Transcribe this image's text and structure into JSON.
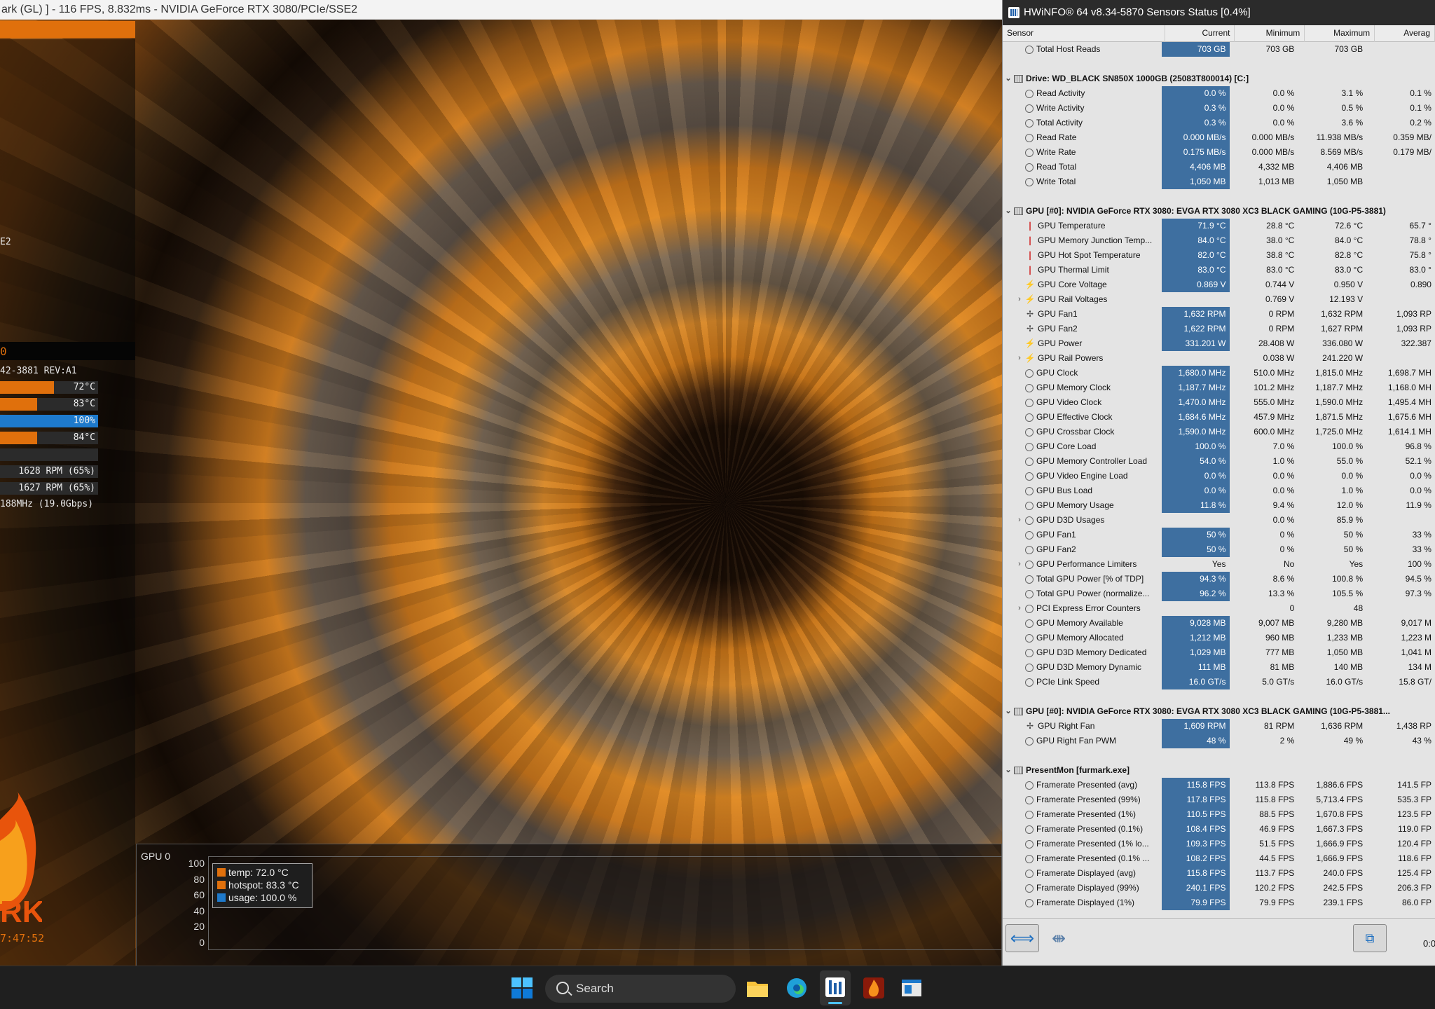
{
  "app_title": "ark (GL) ] - 116 FPS, 8.832ms - NVIDIA GeForce RTX 3080/PCIe/SSE2",
  "left_panel": {
    "sse": "E2",
    "black_label": "0",
    "gpu_line": "42-3881 REV:A1",
    "bars": [
      {
        "label": "72°C",
        "fill": 0.55,
        "color": "orange"
      },
      {
        "label": "83°C",
        "fill": 0.38,
        "color": "orange"
      },
      {
        "label": "100%",
        "fill": 1.0,
        "color": "blue"
      },
      {
        "label": "84°C",
        "fill": 0.38,
        "color": "orange"
      },
      {
        "label": "",
        "fill": 0.0,
        "color": "orange"
      },
      {
        "label": "1628 RPM (65%)",
        "fill": 0.0,
        "color": "orange"
      },
      {
        "label": "1627 RPM (65%)",
        "fill": 0.0,
        "color": "orange"
      }
    ],
    "mem_line": "188MHz (19.0Gbps)",
    "time": "7:47:52"
  },
  "graph": {
    "gpu_label": "GPU 0",
    "y_ticks": [
      "100",
      "80",
      "60",
      "40",
      "20",
      "0"
    ],
    "legend": [
      {
        "text": "temp: 72.0 °C",
        "color": "#e0700c"
      },
      {
        "text": "hotspot: 83.3 °C",
        "color": "#e0700c"
      },
      {
        "text": "usage: 100.0 %",
        "color": "#1e7acc"
      }
    ]
  },
  "hwinfo": {
    "title": "HWiNFO® 64 v8.34-5870 Sensors Status [0.4%]",
    "columns": [
      "Sensor",
      "Current",
      "Minimum",
      "Maximum",
      "Averag"
    ],
    "rows": [
      {
        "t": "item",
        "icon": "clock",
        "name": "Total Host Reads",
        "v": [
          "703 GB",
          "703 GB",
          "703 GB",
          ""
        ]
      },
      {
        "t": "empty"
      },
      {
        "t": "hdr",
        "name": "Drive: WD_BLACK SN850X 1000GB (25083T800014) [C:]"
      },
      {
        "t": "item",
        "icon": "clock",
        "name": "Read Activity",
        "v": [
          "0.0 %",
          "0.0 %",
          "3.1 %",
          "0.1 %"
        ]
      },
      {
        "t": "item",
        "icon": "clock",
        "name": "Write Activity",
        "v": [
          "0.3 %",
          "0.0 %",
          "0.5 %",
          "0.1 %"
        ]
      },
      {
        "t": "item",
        "icon": "clock",
        "name": "Total Activity",
        "v": [
          "0.3 %",
          "0.0 %",
          "3.6 %",
          "0.2 %"
        ]
      },
      {
        "t": "item",
        "icon": "clock",
        "name": "Read Rate",
        "v": [
          "0.000 MB/s",
          "0.000 MB/s",
          "11.938 MB/s",
          "0.359 MB/"
        ]
      },
      {
        "t": "item",
        "icon": "clock",
        "name": "Write Rate",
        "v": [
          "0.175 MB/s",
          "0.000 MB/s",
          "8.569 MB/s",
          "0.179 MB/"
        ]
      },
      {
        "t": "item",
        "icon": "clock",
        "name": "Read Total",
        "v": [
          "4,406 MB",
          "4,332 MB",
          "4,406 MB",
          ""
        ]
      },
      {
        "t": "item",
        "icon": "clock",
        "name": "Write Total",
        "v": [
          "1,050 MB",
          "1,013 MB",
          "1,050 MB",
          ""
        ]
      },
      {
        "t": "empty"
      },
      {
        "t": "hdr",
        "name": "GPU [#0]: NVIDIA GeForce RTX 3080: EVGA RTX 3080 XC3 BLACK GAMING (10G-P5-3881)"
      },
      {
        "t": "item",
        "icon": "therm",
        "name": "GPU Temperature",
        "v": [
          "71.9 °C",
          "28.8 °C",
          "72.6 °C",
          "65.7 °"
        ]
      },
      {
        "t": "item",
        "icon": "therm",
        "name": "GPU Memory Junction Temp...",
        "v": [
          "84.0 °C",
          "38.0 °C",
          "84.0 °C",
          "78.8 °"
        ]
      },
      {
        "t": "item",
        "icon": "therm",
        "name": "GPU Hot Spot Temperature",
        "v": [
          "82.0 °C",
          "38.8 °C",
          "82.8 °C",
          "75.8 °"
        ]
      },
      {
        "t": "item",
        "icon": "therm",
        "name": "GPU Thermal Limit",
        "v": [
          "83.0 °C",
          "83.0 °C",
          "83.0 °C",
          "83.0 °"
        ]
      },
      {
        "t": "item",
        "icon": "bolt",
        "name": "GPU Core Voltage",
        "v": [
          "0.869 V",
          "0.744 V",
          "0.950 V",
          "0.890 "
        ]
      },
      {
        "t": "sub",
        "icon": "bolt",
        "name": "GPU Rail Voltages",
        "v": [
          "",
          "0.769 V",
          "12.193 V",
          ""
        ]
      },
      {
        "t": "item",
        "icon": "fan",
        "name": "GPU Fan1",
        "v": [
          "1,632 RPM",
          "0 RPM",
          "1,632 RPM",
          "1,093 RP"
        ]
      },
      {
        "t": "item",
        "icon": "fan",
        "name": "GPU Fan2",
        "v": [
          "1,622 RPM",
          "0 RPM",
          "1,627 RPM",
          "1,093 RP"
        ]
      },
      {
        "t": "item",
        "icon": "bolt",
        "name": "GPU Power",
        "v": [
          "331.201 W",
          "28.408 W",
          "336.080 W",
          "322.387 "
        ]
      },
      {
        "t": "sub",
        "icon": "bolt",
        "name": "GPU Rail Powers",
        "v": [
          "",
          "0.038 W",
          "241.220 W",
          ""
        ]
      },
      {
        "t": "item",
        "icon": "clock",
        "name": "GPU Clock",
        "v": [
          "1,680.0 MHz",
          "510.0 MHz",
          "1,815.0 MHz",
          "1,698.7 MH"
        ]
      },
      {
        "t": "item",
        "icon": "clock",
        "name": "GPU Memory Clock",
        "v": [
          "1,187.7 MHz",
          "101.2 MHz",
          "1,187.7 MHz",
          "1,168.0 MH"
        ]
      },
      {
        "t": "item",
        "icon": "clock",
        "name": "GPU Video Clock",
        "v": [
          "1,470.0 MHz",
          "555.0 MHz",
          "1,590.0 MHz",
          "1,495.4 MH"
        ]
      },
      {
        "t": "item",
        "icon": "clock",
        "name": "GPU Effective Clock",
        "v": [
          "1,684.6 MHz",
          "457.9 MHz",
          "1,871.5 MHz",
          "1,675.6 MH"
        ]
      },
      {
        "t": "item",
        "icon": "clock",
        "name": "GPU Crossbar Clock",
        "v": [
          "1,590.0 MHz",
          "600.0 MHz",
          "1,725.0 MHz",
          "1,614.1 MH"
        ]
      },
      {
        "t": "item",
        "icon": "clock",
        "name": "GPU Core Load",
        "v": [
          "100.0 %",
          "7.0 %",
          "100.0 %",
          "96.8 %"
        ]
      },
      {
        "t": "item",
        "icon": "clock",
        "name": "GPU Memory Controller Load",
        "v": [
          "54.0 %",
          "1.0 %",
          "55.0 %",
          "52.1 %"
        ]
      },
      {
        "t": "item",
        "icon": "clock",
        "name": "GPU Video Engine Load",
        "v": [
          "0.0 %",
          "0.0 %",
          "0.0 %",
          "0.0 %"
        ]
      },
      {
        "t": "item",
        "icon": "clock",
        "name": "GPU Bus Load",
        "v": [
          "0.0 %",
          "0.0 %",
          "1.0 %",
          "0.0 %"
        ]
      },
      {
        "t": "item",
        "icon": "clock",
        "name": "GPU Memory Usage",
        "v": [
          "11.8 %",
          "9.4 %",
          "12.0 %",
          "11.9 %"
        ]
      },
      {
        "t": "sub",
        "icon": "clock",
        "name": "GPU D3D Usages",
        "v": [
          "",
          "0.0 %",
          "85.9 %",
          ""
        ]
      },
      {
        "t": "item",
        "icon": "clock",
        "name": "GPU Fan1",
        "v": [
          "50 %",
          "0 %",
          "50 %",
          "33 %"
        ]
      },
      {
        "t": "item",
        "icon": "clock",
        "name": "GPU Fan2",
        "v": [
          "50 %",
          "0 %",
          "50 %",
          "33 %"
        ]
      },
      {
        "t": "sub",
        "icon": "clock",
        "name": "GPU Performance Limiters",
        "v": [
          "Yes",
          "No",
          "Yes",
          "100 %"
        ]
      },
      {
        "t": "item",
        "icon": "clock",
        "name": "Total GPU Power [% of TDP]",
        "v": [
          "94.3 %",
          "8.6 %",
          "100.8 %",
          "94.5 %"
        ]
      },
      {
        "t": "item",
        "icon": "clock",
        "name": "Total GPU Power (normalize...",
        "v": [
          "96.2 %",
          "13.3 %",
          "105.5 %",
          "97.3 %"
        ]
      },
      {
        "t": "sub",
        "icon": "clock",
        "name": "PCI Express Error Counters",
        "v": [
          "",
          "0",
          "48",
          ""
        ]
      },
      {
        "t": "item",
        "icon": "clock",
        "name": "GPU Memory Available",
        "v": [
          "9,028 MB",
          "9,007 MB",
          "9,280 MB",
          "9,017 M"
        ]
      },
      {
        "t": "item",
        "icon": "clock",
        "name": "GPU Memory Allocated",
        "v": [
          "1,212 MB",
          "960 MB",
          "1,233 MB",
          "1,223 M"
        ]
      },
      {
        "t": "item",
        "icon": "clock",
        "name": "GPU D3D Memory Dedicated",
        "v": [
          "1,029 MB",
          "777 MB",
          "1,050 MB",
          "1,041 M"
        ]
      },
      {
        "t": "item",
        "icon": "clock",
        "name": "GPU D3D Memory Dynamic",
        "v": [
          "111 MB",
          "81 MB",
          "140 MB",
          "134 M"
        ]
      },
      {
        "t": "item",
        "icon": "clock",
        "name": "PCIe Link Speed",
        "v": [
          "16.0 GT/s",
          "5.0 GT/s",
          "16.0 GT/s",
          "15.8 GT/"
        ]
      },
      {
        "t": "empty"
      },
      {
        "t": "hdr",
        "name": "GPU [#0]: NVIDIA GeForce RTX 3080: EVGA RTX 3080 XC3 BLACK GAMING (10G-P5-3881..."
      },
      {
        "t": "item",
        "icon": "fan",
        "name": "GPU Right Fan",
        "v": [
          "1,609 RPM",
          "81 RPM",
          "1,636 RPM",
          "1,438 RP"
        ]
      },
      {
        "t": "item",
        "icon": "clock",
        "name": "GPU Right Fan PWM",
        "v": [
          "48 %",
          "2 %",
          "49 %",
          "43 %"
        ]
      },
      {
        "t": "empty"
      },
      {
        "t": "hdr",
        "name": "PresentMon [furmark.exe]"
      },
      {
        "t": "item",
        "icon": "clock",
        "name": "Framerate Presented (avg)",
        "v": [
          "115.8 FPS",
          "113.8 FPS",
          "1,886.6 FPS",
          "141.5 FP"
        ]
      },
      {
        "t": "item",
        "icon": "clock",
        "name": "Framerate Presented (99%)",
        "v": [
          "117.8 FPS",
          "115.8 FPS",
          "5,713.4 FPS",
          "535.3 FP"
        ]
      },
      {
        "t": "item",
        "icon": "clock",
        "name": "Framerate Presented (1%)",
        "v": [
          "110.5 FPS",
          "88.5 FPS",
          "1,670.8 FPS",
          "123.5 FP"
        ]
      },
      {
        "t": "item",
        "icon": "clock",
        "name": "Framerate Presented (0.1%)",
        "v": [
          "108.4 FPS",
          "46.9 FPS",
          "1,667.3 FPS",
          "119.0 FP"
        ]
      },
      {
        "t": "item",
        "icon": "clock",
        "name": "Framerate Presented (1% lo...",
        "v": [
          "109.3 FPS",
          "51.5 FPS",
          "1,666.9 FPS",
          "120.4 FP"
        ]
      },
      {
        "t": "item",
        "icon": "clock",
        "name": "Framerate Presented (0.1% ...",
        "v": [
          "108.2 FPS",
          "44.5 FPS",
          "1,666.9 FPS",
          "118.6 FP"
        ]
      },
      {
        "t": "item",
        "icon": "clock",
        "name": "Framerate Displayed (avg)",
        "v": [
          "115.8 FPS",
          "113.7 FPS",
          "240.0 FPS",
          "125.4 FP"
        ]
      },
      {
        "t": "item",
        "icon": "clock",
        "name": "Framerate Displayed (99%)",
        "v": [
          "240.1 FPS",
          "120.2 FPS",
          "242.5 FPS",
          "206.3 FP"
        ]
      },
      {
        "t": "item",
        "icon": "clock",
        "name": "Framerate Displayed (1%)",
        "v": [
          "79.9 FPS",
          "79.9 FPS",
          "239.1 FPS",
          "86.0 FP"
        ]
      }
    ],
    "footer_time": "0:0"
  },
  "taskbar": {
    "search_label": "Search"
  }
}
